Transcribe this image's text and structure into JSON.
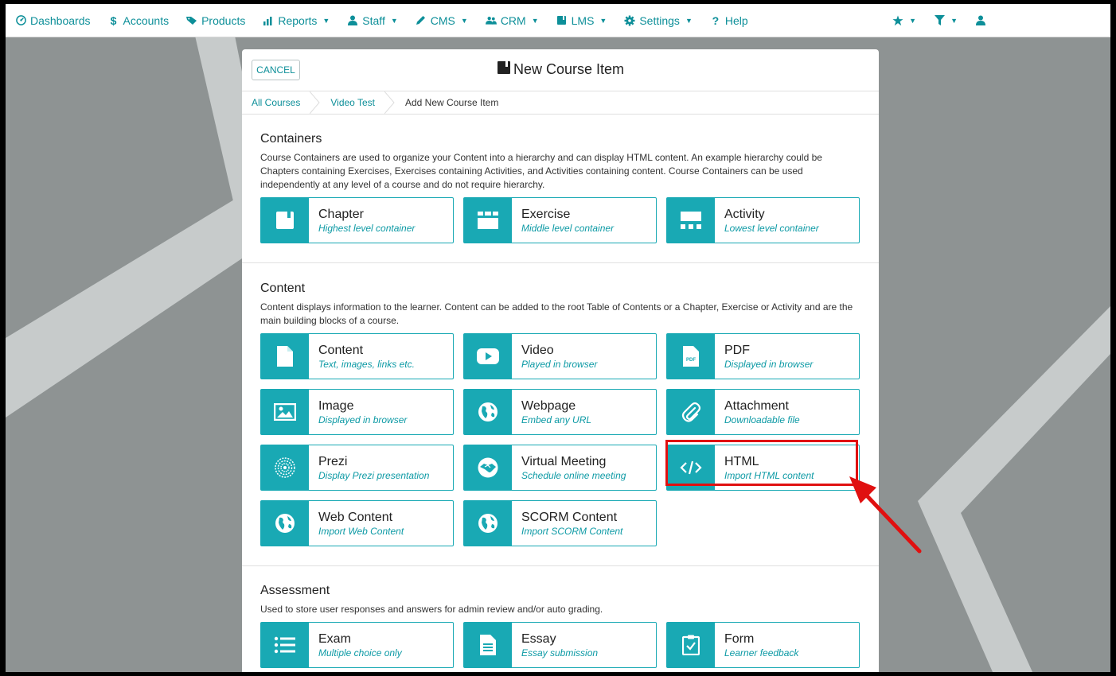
{
  "nav": {
    "items": [
      {
        "label": "Dashboards",
        "icon": "dashboard-icon",
        "caret": false
      },
      {
        "label": "Accounts",
        "icon": "dollar-icon",
        "caret": false
      },
      {
        "label": "Products",
        "icon": "tag-icon",
        "caret": false
      },
      {
        "label": "Reports",
        "icon": "chart-icon",
        "caret": true
      },
      {
        "label": "Staff",
        "icon": "user-icon",
        "caret": true
      },
      {
        "label": "CMS",
        "icon": "pencil-icon",
        "caret": true
      },
      {
        "label": "CRM",
        "icon": "users-icon",
        "caret": true
      },
      {
        "label": "LMS",
        "icon": "book-icon",
        "caret": true
      },
      {
        "label": "Settings",
        "icon": "gear-icon",
        "caret": true
      },
      {
        "label": "Help",
        "icon": "question-icon",
        "caret": false
      }
    ],
    "right": [
      "star-icon",
      "filter-icon",
      "user-icon"
    ]
  },
  "panel": {
    "cancel_label": "CANCEL",
    "title": "New Course Item",
    "breadcrumbs": [
      "All Courses",
      "Video Test",
      "Add New Course Item"
    ]
  },
  "sections": [
    {
      "title": "Containers",
      "description": "Course Containers are used to organize your Content into a hierarchy and can display HTML content. An example hierarchy could be Chapters containing Exercises, Exercises containing Activities, and Activities containing content. Course Containers can be used independently at any level of a course and do not require hierarchy.",
      "items": [
        {
          "name": "Chapter",
          "sub": "Highest level container",
          "icon": "chapter-icon"
        },
        {
          "name": "Exercise",
          "sub": "Middle level container",
          "icon": "exercise-icon"
        },
        {
          "name": "Activity",
          "sub": "Lowest level container",
          "icon": "activity-icon"
        }
      ]
    },
    {
      "title": "Content",
      "description": "Content displays information to the learner. Content can be added to the root Table of Contents or a Chapter, Exercise or Activity and are the main building blocks of a course.",
      "items": [
        {
          "name": "Content",
          "sub": "Text, images, links etc.",
          "icon": "document-icon"
        },
        {
          "name": "Video",
          "sub": "Played in browser",
          "icon": "youtube-icon"
        },
        {
          "name": "PDF",
          "sub": "Displayed in browser",
          "icon": "pdf-icon"
        },
        {
          "name": "Image",
          "sub": "Displayed in browser",
          "icon": "image-icon"
        },
        {
          "name": "Webpage",
          "sub": "Embed any URL",
          "icon": "globe-icon"
        },
        {
          "name": "Attachment",
          "sub": "Downloadable file",
          "icon": "paperclip-icon"
        },
        {
          "name": "Prezi",
          "sub": "Display Prezi presentation",
          "icon": "prezi-icon"
        },
        {
          "name": "Virtual Meeting",
          "sub": "Schedule online meeting",
          "icon": "handshake-icon"
        },
        {
          "name": "HTML",
          "sub": "Import HTML content",
          "icon": "code-icon"
        },
        {
          "name": "Web Content",
          "sub": "Import Web Content",
          "icon": "globe-icon"
        },
        {
          "name": "SCORM Content",
          "sub": "Import SCORM Content",
          "icon": "globe-icon"
        }
      ]
    },
    {
      "title": "Assessment",
      "description": "Used to store user responses and answers for admin review and/or auto grading.",
      "items": [
        {
          "name": "Exam",
          "sub": "Multiple choice only",
          "icon": "list-icon"
        },
        {
          "name": "Essay",
          "sub": "Essay submission",
          "icon": "essay-icon"
        },
        {
          "name": "Form",
          "sub": "Learner feedback",
          "icon": "clipboard-check-icon"
        }
      ]
    }
  ],
  "colors": {
    "accent": "#19a9b4",
    "link": "#0d8f99",
    "highlight": "#e01010",
    "background": "#8e9393"
  }
}
